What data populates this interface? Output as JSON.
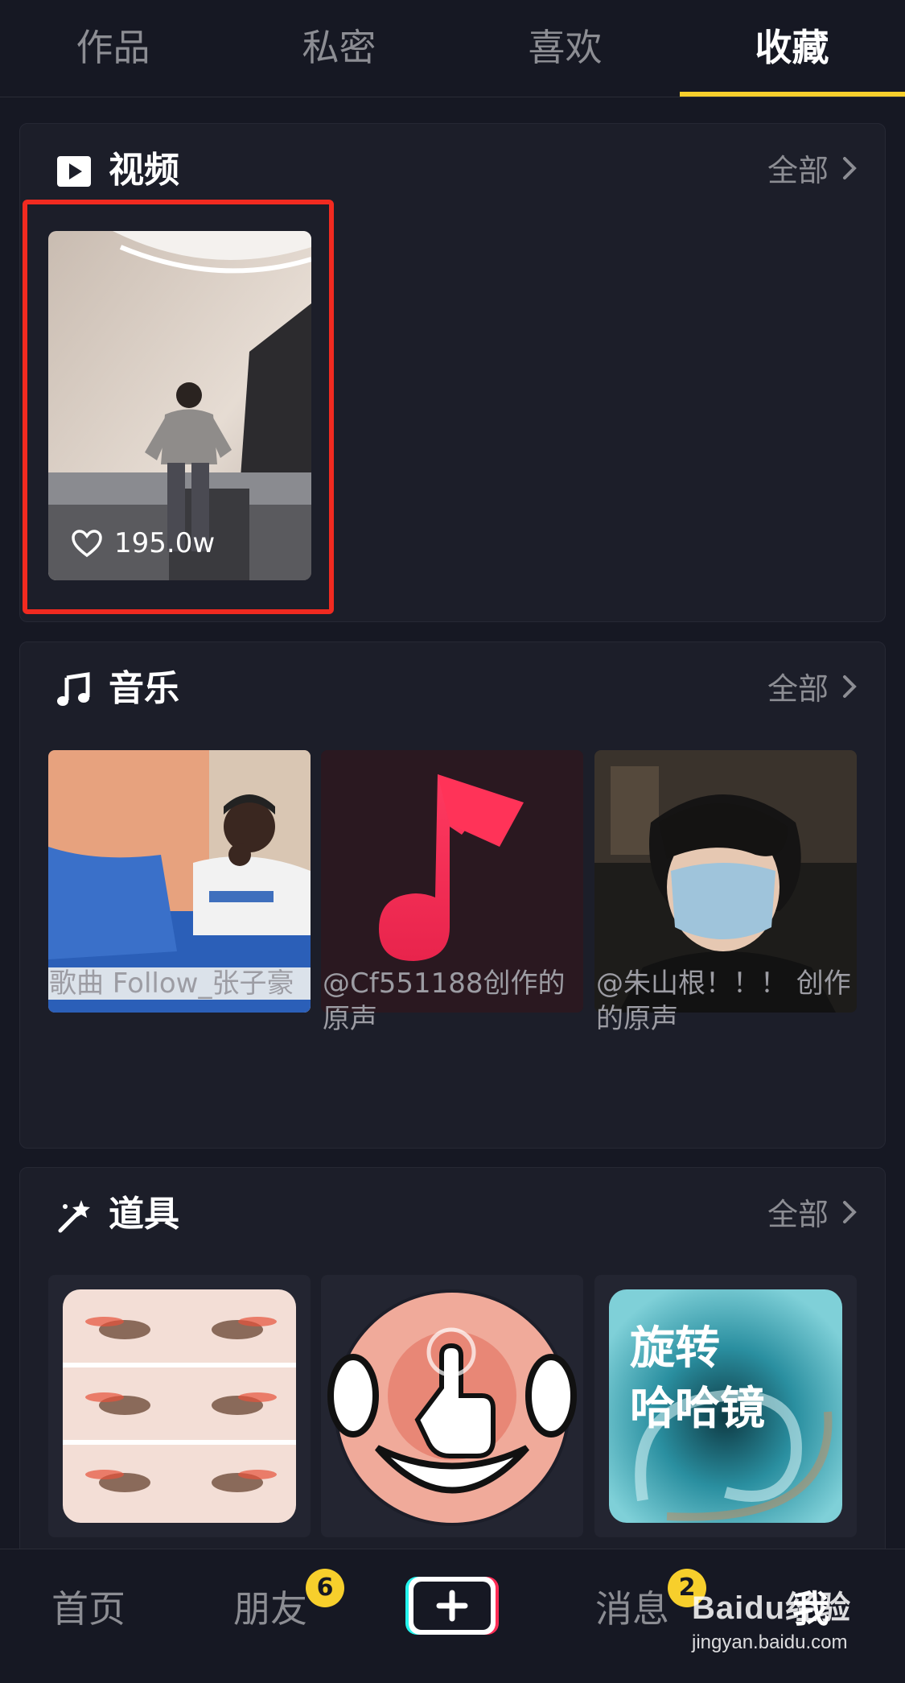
{
  "tabs": [
    {
      "label": "作品"
    },
    {
      "label": "私密"
    },
    {
      "label": "喜欢"
    },
    {
      "label": "收藏",
      "active": true
    }
  ],
  "sections": {
    "video": {
      "title": "视频",
      "more": "全部",
      "icon": "video-play-icon",
      "items": [
        {
          "likes": "195.0w"
        }
      ]
    },
    "music": {
      "title": "音乐",
      "more": "全部",
      "icon": "music-note-icon",
      "items": [
        {
          "caption": "歌曲 Follow_张子豪"
        },
        {
          "caption": "@Cf551188创作的原声"
        },
        {
          "caption": "@朱山根！！！ 创作的原声"
        }
      ]
    },
    "props": {
      "title": "道具",
      "more": "全部",
      "icon": "magic-wand-icon",
      "items": [
        {
          "name": "eye-makeup-effect"
        },
        {
          "name": "funny-face-effect"
        },
        {
          "text": "旋转\n哈哈镜"
        }
      ]
    }
  },
  "bottom_nav": {
    "home": "首页",
    "friends": "朋友",
    "friends_badge": "6",
    "messages": "消息",
    "messages_badge": "2",
    "me": "我"
  },
  "watermark": {
    "logo": "Baidu经验",
    "url": "jingyan.baidu.com"
  },
  "colors": {
    "background": "#161823",
    "accent": "#f7cf2c",
    "highlight": "#f12a20",
    "muted_text": "#8c8d93"
  }
}
